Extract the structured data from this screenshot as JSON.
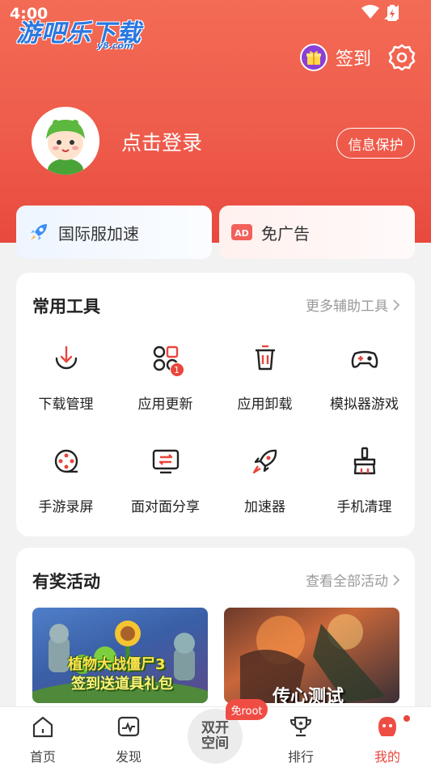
{
  "status": {
    "time": "4:00"
  },
  "watermark": {
    "main": "游吧乐下载",
    "sub": "y8.com"
  },
  "header": {
    "checkin_label": "签到",
    "login_text": "点击登录",
    "privacy_label": "信息保护"
  },
  "quick": [
    {
      "label": "国际服加速",
      "icon": "rocket-icon"
    },
    {
      "label": "免广告",
      "icon": "ad-icon"
    }
  ],
  "tools": {
    "title": "常用工具",
    "more": "更多辅助工具",
    "items": [
      {
        "label": "下载管理",
        "icon": "download-icon"
      },
      {
        "label": "应用更新",
        "icon": "apps-update-icon",
        "badge": "1"
      },
      {
        "label": "应用卸载",
        "icon": "trash-icon"
      },
      {
        "label": "模拟器游戏",
        "icon": "gamepad-icon"
      },
      {
        "label": "手游录屏",
        "icon": "film-reel-icon"
      },
      {
        "label": "面对面分享",
        "icon": "share-screen-icon"
      },
      {
        "label": "加速器",
        "icon": "rocket-outline-icon"
      },
      {
        "label": "手机清理",
        "icon": "broom-icon"
      }
    ]
  },
  "activity": {
    "title": "有奖活动",
    "more": "查看全部活动",
    "banners": [
      {
        "text_line1": "植物大战僵尸3",
        "text_line2": "签到送道具礼包"
      },
      {
        "text": "传心测试"
      }
    ]
  },
  "tabbar": {
    "items": [
      {
        "label": "首页",
        "icon": "home-icon"
      },
      {
        "label": "发现",
        "icon": "discover-icon"
      },
      {
        "label": "排行",
        "icon": "trophy-icon"
      },
      {
        "label": "我的",
        "icon": "profile-icon"
      }
    ],
    "center_label": "双开空间",
    "center_badge": "免root"
  },
  "colors": {
    "accent": "#ee5a4a",
    "badge": "#e9463c"
  }
}
